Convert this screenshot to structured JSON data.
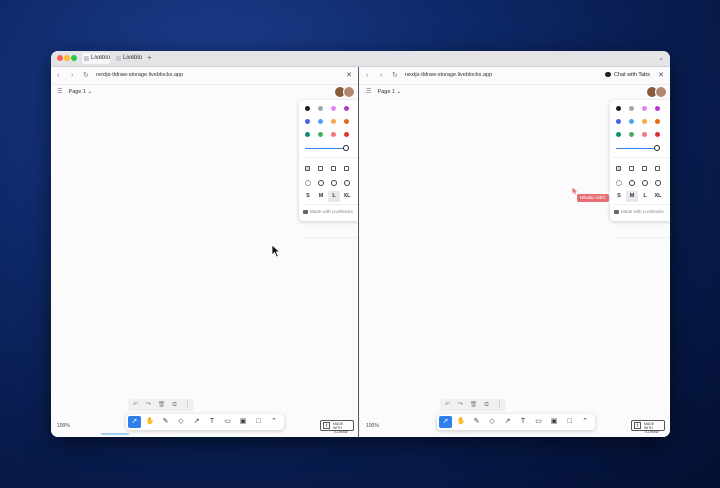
{
  "browser": {
    "tabs": [
      {
        "label": "Liveblo"
      },
      {
        "label": "Liveblo"
      }
    ],
    "new_tab": "+",
    "chevron": "⌄"
  },
  "left": {
    "url": "nextjs-tldraw-storage.liveblocks.app",
    "page_label": "Page 1",
    "zoom": "100%",
    "made_with": "Made with Liveblocks"
  },
  "right": {
    "url": "nextjs-tldraw-storage.liveblocks.app",
    "page_label": "Page 1",
    "zoom": "100%",
    "made_with": "Made with Liveblocks",
    "chat_label": "Chat with Tabs",
    "peer_name": "Nikolai Aldrić"
  },
  "style_panel": {
    "colors": [
      "#1d1d1d",
      "#9fa8b2",
      "#e085f4",
      "#ae3ec9",
      "#4465e9",
      "#4ba1f1",
      "#f1ac4b",
      "#e16919",
      "#099268",
      "#4cb05e",
      "#f87777",
      "#e03131"
    ],
    "accent": "#2f80ed",
    "sizes": [
      "S",
      "M",
      "L",
      "XL"
    ],
    "selected_size_left": "L",
    "selected_size_right": "M",
    "opacity_fraction": 1.0
  },
  "toolbar": {
    "tools": [
      "select-icon",
      "hand-icon",
      "draw-icon",
      "eraser-icon",
      "arrow-icon",
      "text-icon",
      "note-icon",
      "image-icon",
      "rectangle-icon",
      "more-icon"
    ],
    "actions": [
      "undo-icon",
      "redo-icon",
      "delete-icon",
      "duplicate-icon",
      "more-icon"
    ]
  },
  "badge": {
    "line1": "MADE WITH",
    "line2": "TLDRAW"
  },
  "peer_color": "#e86d72"
}
